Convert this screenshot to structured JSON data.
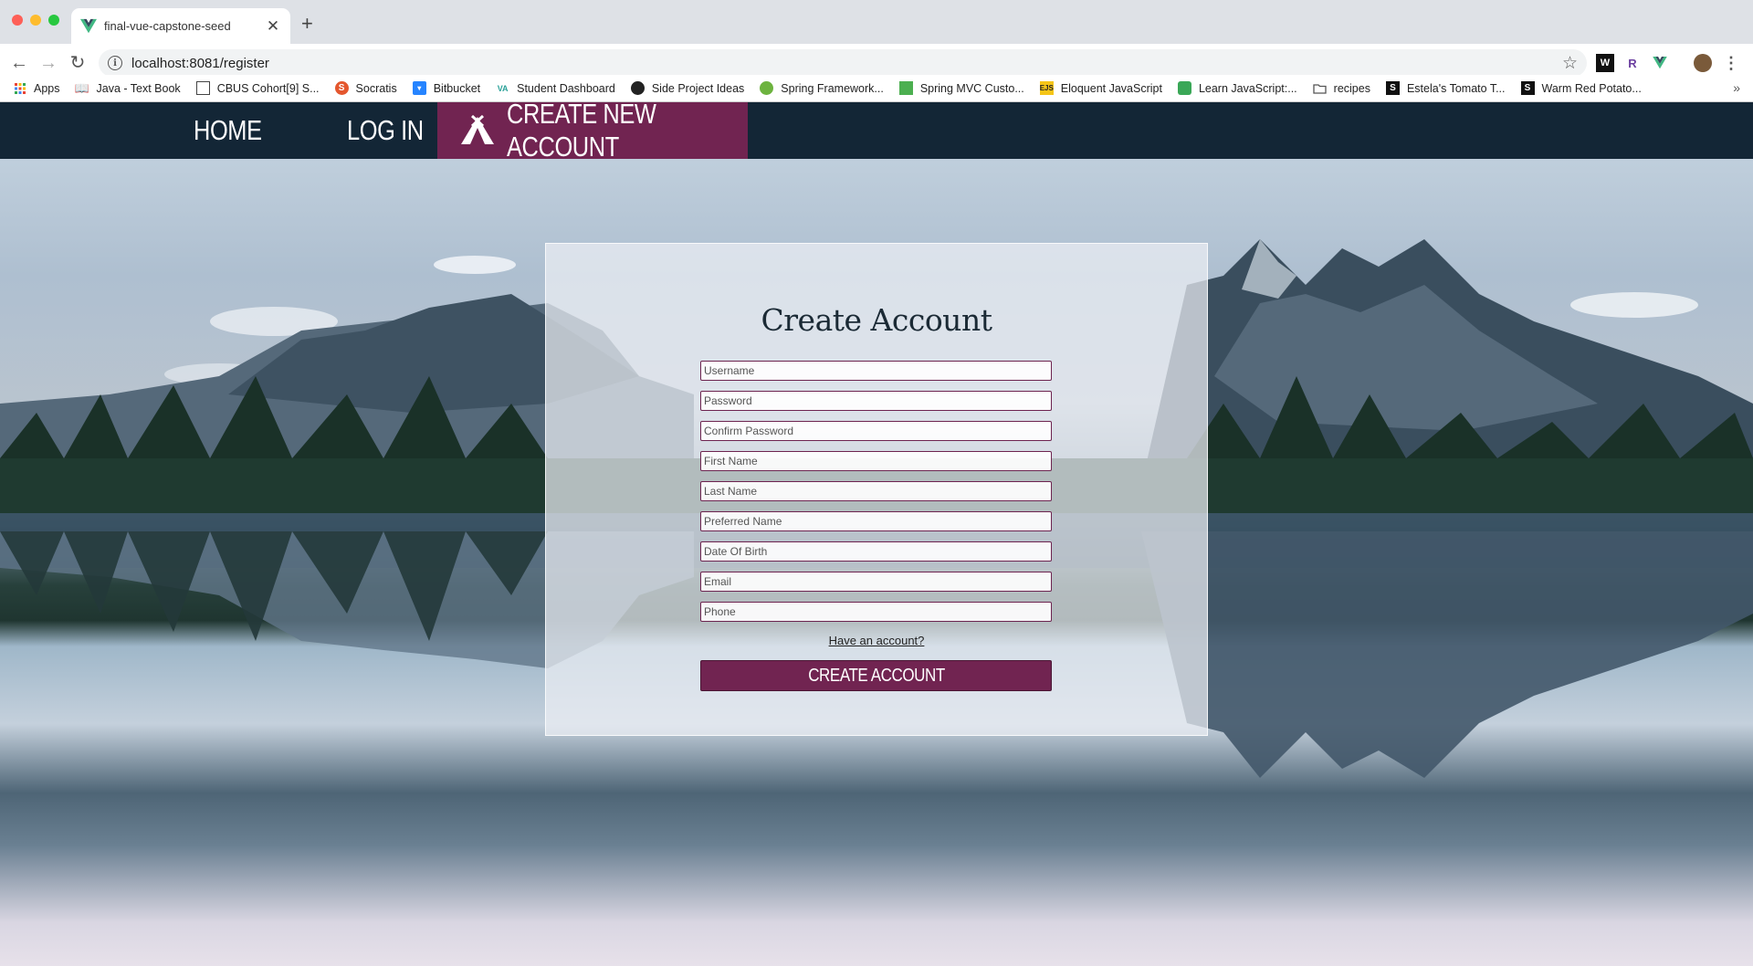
{
  "browser": {
    "tab_title": "final-vue-capstone-seed",
    "tab_close": "✕",
    "new_tab": "+",
    "url": "localhost:8081/register",
    "back": "←",
    "forward": "→",
    "reload": "↻",
    "star": "☆",
    "menu": "⋮",
    "bookmarks": [
      {
        "label": "Apps",
        "icon": "apps-grid-icon"
      },
      {
        "label": "Java - Text Book",
        "icon": "book-icon"
      },
      {
        "label": "CBUS Cohort[9] S...",
        "icon": "board-icon"
      },
      {
        "label": "Socratis",
        "icon": "s-badge-icon"
      },
      {
        "label": "Bitbucket",
        "icon": "bitbucket-icon"
      },
      {
        "label": "Student Dashboard",
        "icon": "va-icon"
      },
      {
        "label": "Side Project Ideas",
        "icon": "github-icon"
      },
      {
        "label": "Spring Framework...",
        "icon": "spring-leaf-icon"
      },
      {
        "label": "Spring MVC Custo...",
        "icon": "green-square-icon"
      },
      {
        "label": "Eloquent JavaScript",
        "icon": "ejs-icon"
      },
      {
        "label": "Learn JavaScript:...",
        "icon": "learn-js-icon"
      },
      {
        "label": "recipes",
        "icon": "folder-icon"
      },
      {
        "label": "Estela's Tomato T...",
        "icon": "s-square-icon"
      },
      {
        "label": "Warm Red Potato...",
        "icon": "s-square-icon"
      }
    ],
    "bookmarks_more": "»"
  },
  "nav": {
    "home": "HOME",
    "login": "LOG IN",
    "create": "CREATE NEW ACCOUNT",
    "active_color": "#712451",
    "bar_color": "#132636"
  },
  "form": {
    "title": "Create Account",
    "fields": {
      "username": "Username",
      "password": "Password",
      "confirm_password": "Confirm Password",
      "first_name": "First Name",
      "last_name": "Last Name",
      "preferred_name": "Preferred Name",
      "date_of_birth": "Date Of Birth",
      "email": "Email",
      "phone": "Phone"
    },
    "have_account": "Have an account?",
    "submit": "CREATE ACCOUNT"
  }
}
